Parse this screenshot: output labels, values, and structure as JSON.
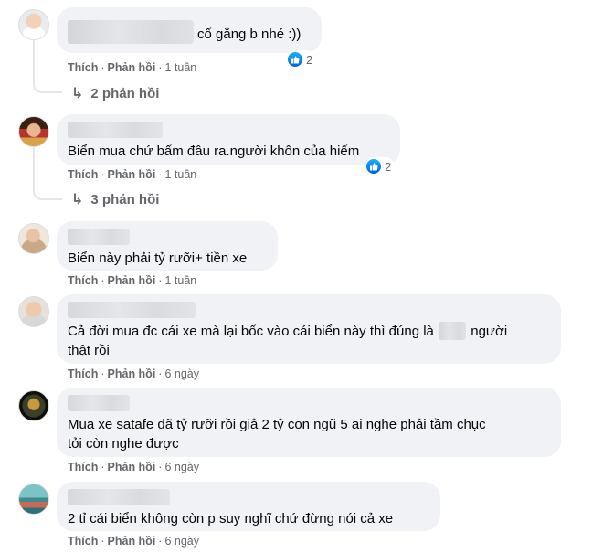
{
  "comments": [
    {
      "text": "cố gắng b nhé :))",
      "like_label": "Thích",
      "reply_label": "Phản hồi",
      "time": "1 tuần",
      "reactions": "2",
      "replies": "2 phản hồi"
    },
    {
      "text": "Biển mua chứ bấm đâu ra.người khôn của hiếm",
      "like_label": "Thích",
      "reply_label": "Phản hồi",
      "time": "1 tuần",
      "reactions": "2",
      "replies": "3 phản hồi"
    },
    {
      "text": "Biển này phải tỷ rưỡi+ tiền xe",
      "like_label": "Thích",
      "reply_label": "Phản hồi",
      "time": "1 tuần"
    },
    {
      "text_before": "Cả đời mua đc cái xe mà lại bốc vào cái biển này thì đúng là",
      "text_after": "người",
      "text_line2": "thật rồi",
      "like_label": "Thích",
      "reply_label": "Phản hồi",
      "time": "6 ngày"
    },
    {
      "text_line1": "Mua xe satafe đã tỷ rưỡi rồi giả 2 tỷ con ngũ 5 ai nghe phải tầm chục",
      "text_line2": "tỏi còn nghe được",
      "like_label": "Thích",
      "reply_label": "Phản hồi",
      "time": "6 ngày"
    },
    {
      "text": "2 tỉ cái biển không còn p suy nghĩ chứ đừng nói cả xe",
      "like_label": "Thích",
      "reply_label": "Phản hồi",
      "time": "6 ngày"
    }
  ],
  "colors": {
    "bubble": "#f0f2f5",
    "meta": "#65676b",
    "like": "#1877f2"
  },
  "icons": {
    "reaction": "like-thumb-icon",
    "reply": "reply-arrow-icon"
  }
}
